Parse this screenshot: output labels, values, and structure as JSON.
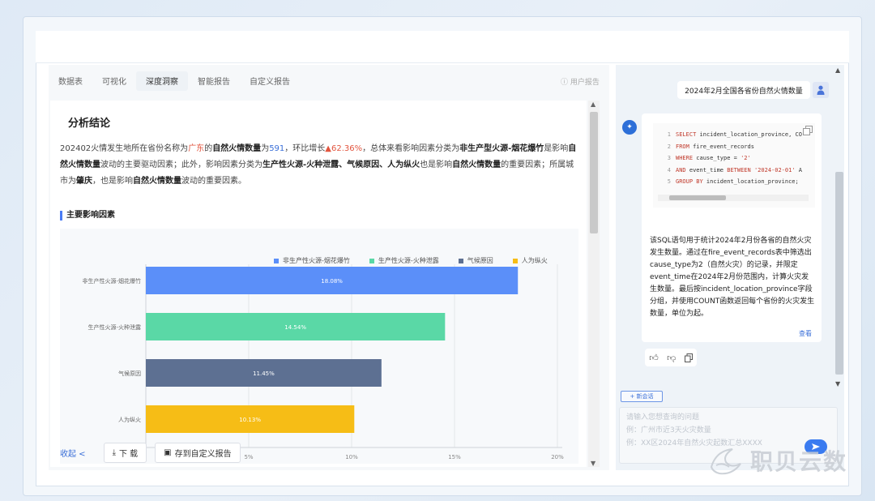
{
  "tabs": [
    "数据表",
    "可视化",
    "深度洞察",
    "智能报告",
    "自定义报告"
  ],
  "active_tab": 2,
  "user_report": "用户报告",
  "analysis": {
    "title": "分析结论",
    "t1": "202402火情发生地所在省份名称为",
    "t2": "广东",
    "t3": "的",
    "t4": "自然火情数量",
    "t5": "为",
    "t6": "591",
    "t7": "，环比增长",
    "t8": "▲62.36%",
    "t9": "，总体来看影响因素分类为",
    "t10": "非生产型火源-烟花爆竹",
    "t11": "是影响",
    "t12": "自然火情数量",
    "t13": "波动的主要驱动因素；此外，影响因素分类为",
    "t14": "生产性火源-火种泄露、气候原因、人为纵火",
    "t15": "也是影响",
    "t16": "自然火情数量",
    "t17": "的重要因素；所属城市为",
    "t18": "肇庆",
    "t19": "，也是影响",
    "t20": "自然火情数量",
    "t21": "波动的重要因素。"
  },
  "factor_title": "主要影响因素",
  "chart_data": {
    "type": "bar",
    "orientation": "horizontal",
    "categories": [
      "非生产性火源-烟花爆竹",
      "生产性火源-火种泄露",
      "气候原因",
      "人为纵火"
    ],
    "values": [
      18.08,
      14.54,
      11.45,
      10.13
    ],
    "value_labels": [
      "18.08%",
      "14.54%",
      "11.45%",
      "10.13%"
    ],
    "colors": [
      "#5b8ff9",
      "#5ad8a6",
      "#5d7092",
      "#f6bd16"
    ],
    "legend": [
      "非生产性火源-烟花爆竹",
      "生产性火源-火种泄露",
      "气候原因",
      "人为纵火"
    ],
    "xticks": [
      "5%",
      "10%",
      "15%",
      "20%"
    ],
    "xtick_values": [
      5,
      10,
      15,
      20
    ],
    "xlim": [
      0,
      20
    ],
    "grid": true,
    "legend_position": "top"
  },
  "actions": {
    "collapse": "收起 <",
    "download": "下 载",
    "save": "存到自定义报告"
  },
  "chat": {
    "user_question": "2024年2月全国各省份自然火情数量",
    "code_lines": [
      {
        "n": "1",
        "parts": [
          [
            "kw",
            "SELECT"
          ],
          [
            "",
            " incident_location_province, CO"
          ]
        ]
      },
      {
        "n": "2",
        "parts": [
          [
            "kw",
            "FROM"
          ],
          [
            "",
            " fire_event_records"
          ]
        ]
      },
      {
        "n": "3",
        "parts": [
          [
            "kw",
            "WHERE"
          ],
          [
            "",
            " cause_type = "
          ],
          [
            "str",
            "'2'"
          ]
        ]
      },
      {
        "n": "4",
        "parts": [
          [
            "kw",
            "AND"
          ],
          [
            "",
            " event_time "
          ],
          [
            "kw",
            "BETWEEN"
          ],
          [
            "",
            " "
          ],
          [
            "str",
            "'2024-02-01'"
          ],
          [
            "",
            " A"
          ]
        ]
      },
      {
        "n": "5",
        "parts": [
          [
            "kw",
            "GROUP BY"
          ],
          [
            "",
            " incident_location_province;"
          ]
        ]
      }
    ],
    "explanation": "该SQL语句用于统计2024年2月份各省的自然火灾发生数量。通过在fire_event_records表中筛选出cause_type为2（自然火灾）的记录，并限定event_time在2024年2月份范围内，计算火灾发生数量。最后按incident_location_province字段分组，并使用COUNT函数返回每个省份的火灾发生数量，单位为起。",
    "view_link": "查看",
    "new_chat": "+ 新会话",
    "input_lines": [
      "请输入您想查询的问题",
      "例：广州市近3天火灾数量",
      "例：XX区2024年自然火灾起数汇总XXXX"
    ]
  },
  "watermark": "职贝云数"
}
